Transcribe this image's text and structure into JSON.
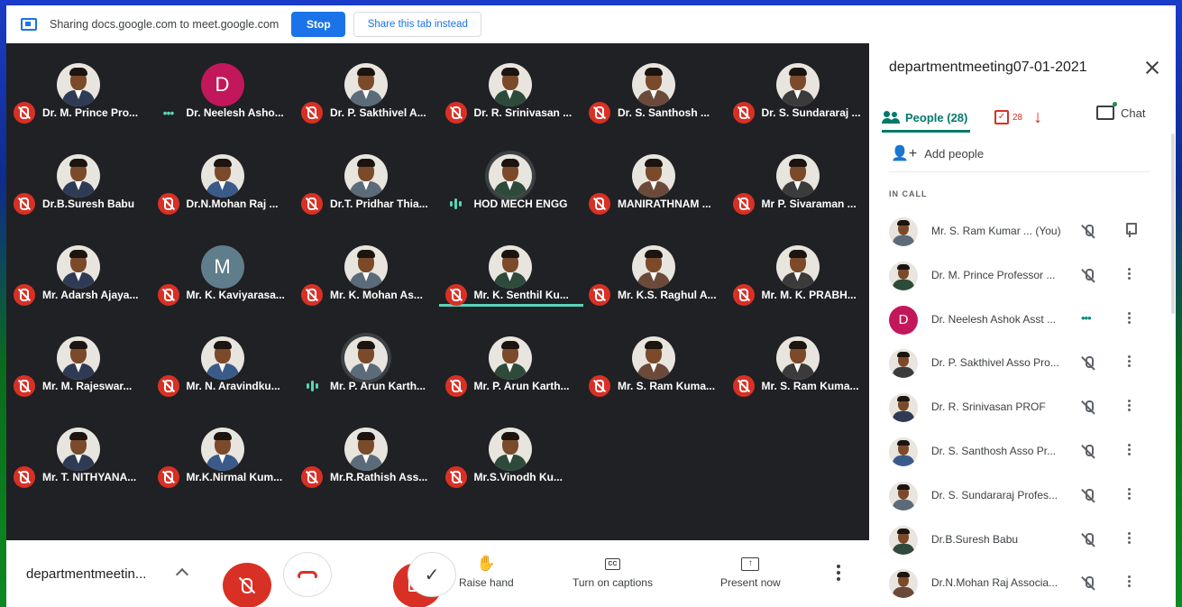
{
  "share_bar": {
    "text": "Sharing docs.google.com to meet.google.com",
    "stop_label": "Stop",
    "share_tab_label": "Share this tab instead"
  },
  "tiles": [
    {
      "name": "Dr. M. Prince Pro...",
      "status": "muted",
      "avatar": "photo"
    },
    {
      "name": "Dr. Neelesh Asho...",
      "status": "dots",
      "avatar": "letter",
      "letter": "D",
      "color": "#c2185b"
    },
    {
      "name": "Dr. P. Sakthivel A...",
      "status": "muted",
      "avatar": "photo"
    },
    {
      "name": "Dr. R. Srinivasan ...",
      "status": "muted",
      "avatar": "photo"
    },
    {
      "name": "Dr. S. Santhosh ...",
      "status": "muted",
      "avatar": "photo"
    },
    {
      "name": "Dr. S. Sundararaj ...",
      "status": "muted",
      "avatar": "photo"
    },
    {
      "name": "Dr.B.Suresh Babu",
      "status": "muted",
      "avatar": "photo"
    },
    {
      "name": "Dr.N.Mohan Raj ...",
      "status": "muted",
      "avatar": "photo"
    },
    {
      "name": "Dr.T. Pridhar Thia...",
      "status": "muted",
      "avatar": "photo"
    },
    {
      "name": "HOD MECH ENGG",
      "status": "speaking",
      "avatar": "photo"
    },
    {
      "name": "MANIRATHNAM ...",
      "status": "muted",
      "avatar": "photo"
    },
    {
      "name": "Mr P. Sivaraman ...",
      "status": "muted",
      "avatar": "photo"
    },
    {
      "name": "Mr. Adarsh Ajaya...",
      "status": "muted",
      "avatar": "photo"
    },
    {
      "name": "Mr. K. Kaviyarasa...",
      "status": "muted",
      "avatar": "letter",
      "letter": "M",
      "color": "#607d8b"
    },
    {
      "name": "Mr. K. Mohan As...",
      "status": "muted",
      "avatar": "photo"
    },
    {
      "name": "Mr. K. Senthil Ku...",
      "status": "muted",
      "avatar": "photo"
    },
    {
      "name": "Mr. K.S. Raghul A...",
      "status": "muted",
      "avatar": "photo"
    },
    {
      "name": "Mr. M. K. PRABH...",
      "status": "muted",
      "avatar": "photo"
    },
    {
      "name": "Mr. M. Rajeswar...",
      "status": "muted",
      "avatar": "photo"
    },
    {
      "name": "Mr. N. Aravindku...",
      "status": "muted",
      "avatar": "photo"
    },
    {
      "name": "Mr. P. Arun Karth...",
      "status": "speaking",
      "avatar": "photo"
    },
    {
      "name": "Mr. P. Arun Karth...",
      "status": "muted",
      "avatar": "photo"
    },
    {
      "name": "Mr. S. Ram Kuma...",
      "status": "muted",
      "avatar": "photo"
    },
    {
      "name": "Mr. S. Ram Kuma...",
      "status": "muted",
      "avatar": "photo"
    },
    {
      "name": "Mr. T. NITHYANA...",
      "status": "muted",
      "avatar": "photo"
    },
    {
      "name": "Mr.K.Nirmal Kum...",
      "status": "muted",
      "avatar": "photo"
    },
    {
      "name": "Mr.R.Rathish Ass...",
      "status": "muted",
      "avatar": "photo"
    },
    {
      "name": "Mr.S.Vinodh Ku...",
      "status": "muted",
      "avatar": "photo"
    }
  ],
  "bottom_bar": {
    "meeting_title": "departmentmeetin...",
    "raise_hand": "Raise hand",
    "captions": "Turn on captions",
    "present": "Present now",
    "cc_icon": "CC"
  },
  "panel": {
    "title": "departmentmeeting07-01-2021",
    "people_tab": "People (28)",
    "tasks_count": "28",
    "chat_tab": "Chat",
    "add_people": "Add people",
    "in_call": "IN CALL",
    "participants": [
      {
        "name": "Mr. S. Ram Kumar ...  (You)",
        "status": "muted",
        "avatar": "photo",
        "action": "pin"
      },
      {
        "name": "Dr. M. Prince Professor ...",
        "status": "muted",
        "avatar": "photo",
        "action": "more"
      },
      {
        "name": "Dr. Neelesh Ashok Asst ...",
        "status": "dots",
        "avatar": "letter",
        "letter": "D",
        "action": "more"
      },
      {
        "name": "Dr. P. Sakthivel Asso Pro...",
        "status": "muted",
        "avatar": "photo",
        "action": "more"
      },
      {
        "name": "Dr. R. Srinivasan PROF",
        "status": "muted",
        "avatar": "photo",
        "action": "more"
      },
      {
        "name": "Dr. S. Santhosh Asso Pr...",
        "status": "muted",
        "avatar": "photo",
        "action": "more"
      },
      {
        "name": "Dr. S. Sundararaj Profes...",
        "status": "muted",
        "avatar": "photo",
        "action": "more"
      },
      {
        "name": "Dr.B.Suresh Babu",
        "status": "muted",
        "avatar": "photo",
        "action": "more"
      },
      {
        "name": "Dr.N.Mohan Raj Associa...",
        "status": "muted",
        "avatar": "photo",
        "action": "more"
      }
    ]
  },
  "colors": {
    "accent": "#1a73e8",
    "muted_red": "#d93025",
    "people_green": "#00796b",
    "speaking_teal": "#5ad4b9"
  }
}
